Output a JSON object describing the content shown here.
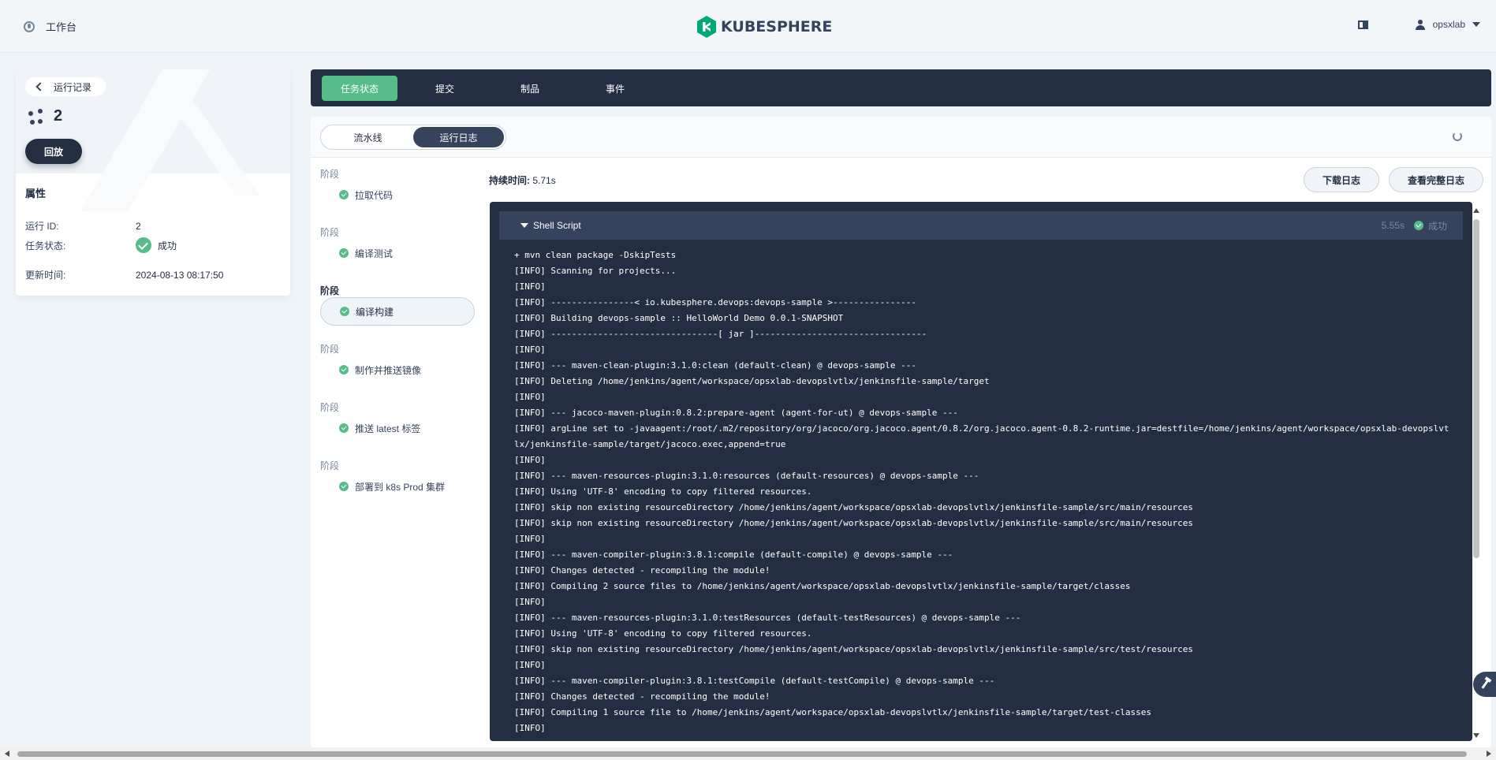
{
  "topbar": {
    "workbench_label": "工作台",
    "logo_text": "KUBESPHERE",
    "username": "opsxlab",
    "icons": {
      "workbench": "dashboard-icon",
      "notice": "notice-icon",
      "user": "user-icon"
    }
  },
  "run": {
    "back_label": "运行记录",
    "run_number": "2",
    "replay_label": "回放",
    "attributes_title": "属性",
    "attributes": [
      {
        "key": "运行 ID:",
        "value": "2"
      },
      {
        "key": "任务状态:",
        "value": "成功"
      },
      {
        "key": "更新时间:",
        "value": "2024-08-13 08:17:50"
      }
    ]
  },
  "tabs": [
    {
      "label": "任务状态",
      "active": true
    },
    {
      "label": "提交",
      "active": false
    },
    {
      "label": "制品",
      "active": false
    },
    {
      "label": "事件",
      "active": false
    }
  ],
  "view_toggle": {
    "options": [
      "流水线",
      "运行日志"
    ],
    "selected": "运行日志"
  },
  "stages": [
    {
      "group_label": "阶段",
      "name": "拉取代码",
      "status": "success",
      "active": false
    },
    {
      "group_label": "阶段",
      "name": "编译测试",
      "status": "success",
      "active": false
    },
    {
      "group_label": "阶段",
      "name": "编译构建",
      "status": "success",
      "active": true
    },
    {
      "group_label": "阶段",
      "name": "制作并推送镜像",
      "status": "success",
      "active": false
    },
    {
      "group_label": "阶段",
      "name": "推送 latest 标签",
      "status": "success",
      "active": false
    },
    {
      "group_label": "阶段",
      "name": "部署到 k8s Prod 集群",
      "status": "success",
      "active": false
    }
  ],
  "log": {
    "duration_label": "持续时间:",
    "duration_value": "5.71s",
    "download_label": "下载日志",
    "view_full_label": "查看完整日志",
    "step_title": "Shell Script",
    "step_duration": "5.55s",
    "step_status": "成功",
    "lines": [
      "+ mvn clean package -DskipTests",
      "[INFO] Scanning for projects...",
      "[INFO]",
      "[INFO] ----------------< io.kubesphere.devops:devops-sample >----------------",
      "[INFO] Building devops-sample :: HelloWorld Demo 0.0.1-SNAPSHOT",
      "[INFO] --------------------------------[ jar ]---------------------------------",
      "[INFO]",
      "[INFO] --- maven-clean-plugin:3.1.0:clean (default-clean) @ devops-sample ---",
      "[INFO] Deleting /home/jenkins/agent/workspace/opsxlab-devopslvtlx/jenkinsfile-sample/target",
      "[INFO]",
      "[INFO] --- jacoco-maven-plugin:0.8.2:prepare-agent (agent-for-ut) @ devops-sample ---",
      "[INFO] argLine set to -javaagent:/root/.m2/repository/org/jacoco/org.jacoco.agent/0.8.2/org.jacoco.agent-0.8.2-runtime.jar=destfile=/home/jenkins/agent/workspace/opsxlab-devopslvtlx/jenkinsfile-sample/target/jacoco.exec,append=true",
      "[INFO]",
      "[INFO] --- maven-resources-plugin:3.1.0:resources (default-resources) @ devops-sample ---",
      "[INFO] Using 'UTF-8' encoding to copy filtered resources.",
      "[INFO] skip non existing resourceDirectory /home/jenkins/agent/workspace/opsxlab-devopslvtlx/jenkinsfile-sample/src/main/resources",
      "[INFO] skip non existing resourceDirectory /home/jenkins/agent/workspace/opsxlab-devopslvtlx/jenkinsfile-sample/src/main/resources",
      "[INFO]",
      "[INFO] --- maven-compiler-plugin:3.8.1:compile (default-compile) @ devops-sample ---",
      "[INFO] Changes detected - recompiling the module!",
      "[INFO] Compiling 2 source files to /home/jenkins/agent/workspace/opsxlab-devopslvtlx/jenkinsfile-sample/target/classes",
      "[INFO]",
      "[INFO] --- maven-resources-plugin:3.1.0:testResources (default-testResources) @ devops-sample ---",
      "[INFO] Using 'UTF-8' encoding to copy filtered resources.",
      "[INFO] skip non existing resourceDirectory /home/jenkins/agent/workspace/opsxlab-devopslvtlx/jenkinsfile-sample/src/test/resources",
      "[INFO]",
      "[INFO] --- maven-compiler-plugin:3.8.1:testCompile (default-testCompile) @ devops-sample ---",
      "[INFO] Changes detected - recompiling the module!",
      "[INFO] Compiling 1 source file to /home/jenkins/agent/workspace/opsxlab-devopslvtlx/jenkinsfile-sample/target/test-classes",
      "[INFO]"
    ]
  },
  "colors": {
    "accent_green": "#55bc8a",
    "dark": "#242e42",
    "log_header": "#36435c",
    "page_bg": "#eff4f9"
  }
}
